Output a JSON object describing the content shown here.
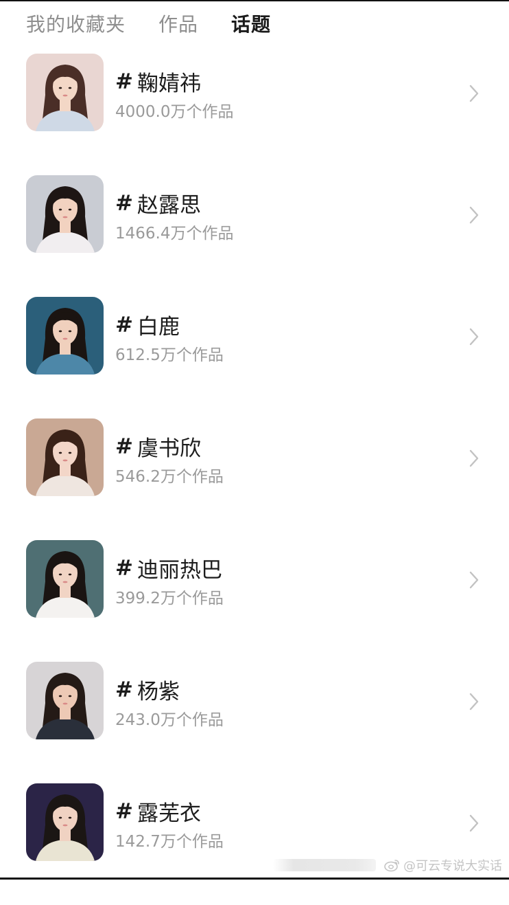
{
  "tabs": [
    {
      "label": "我的收藏夹",
      "active": false
    },
    {
      "label": "作品",
      "active": false
    },
    {
      "label": "话题",
      "active": true
    }
  ],
  "topics": [
    {
      "hash": "#",
      "name": "鞠婧祎",
      "count": "4000.0万个作品",
      "thumb_palette": {
        "bg": "#e9d6d2",
        "hair": "#4a2e27",
        "skin": "#f3d7c6",
        "cloth": "#cfd9e6"
      }
    },
    {
      "hash": "#",
      "name": "赵露思",
      "count": "1466.4万个作品",
      "thumb_palette": {
        "bg": "#c9ccd3",
        "hair": "#1e1614",
        "skin": "#f2d2c0",
        "cloth": "#f1eef0"
      }
    },
    {
      "hash": "#",
      "name": "白鹿",
      "count": "612.5万个作品",
      "thumb_palette": {
        "bg": "#2b5f7a",
        "hair": "#1b1411",
        "skin": "#f0d0bd",
        "cloth": "#4d87a8"
      }
    },
    {
      "hash": "#",
      "name": "虞书欣",
      "count": "546.2万个作品",
      "thumb_palette": {
        "bg": "#c9a894",
        "hair": "#3a2218",
        "skin": "#f3d6c8",
        "cloth": "#efe6e0"
      }
    },
    {
      "hash": "#",
      "name": "迪丽热巴",
      "count": "399.2万个作品",
      "thumb_palette": {
        "bg": "#4f6f73",
        "hair": "#1a1412",
        "skin": "#f1d4c4",
        "cloth": "#f4f2f0"
      }
    },
    {
      "hash": "#",
      "name": "杨紫",
      "count": "243.0万个作品",
      "thumb_palette": {
        "bg": "#d7d4d6",
        "hair": "#241a16",
        "skin": "#edc9b5",
        "cloth": "#2a2f3a"
      }
    },
    {
      "hash": "#",
      "name": "露芜衣",
      "count": "142.7万个作品",
      "thumb_palette": {
        "bg": "#2b2447",
        "hair": "#1b1614",
        "skin": "#f0d2c2",
        "cloth": "#e9e4d3"
      }
    }
  ],
  "watermark": {
    "text": "@可云专说大实话"
  },
  "colors": {
    "chevron": "#c2c2c2",
    "count_text": "#9a9a9a",
    "tab_inactive": "#8e8e8e"
  }
}
